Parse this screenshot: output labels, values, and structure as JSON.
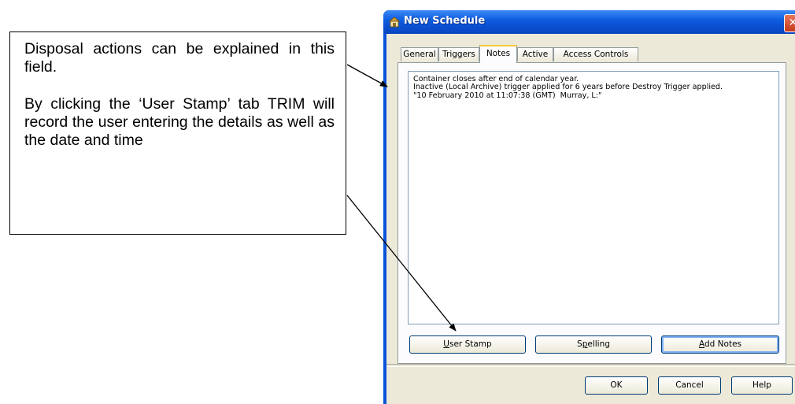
{
  "callout": {
    "paragraph1": "Disposal actions can be explained in this field.",
    "paragraph2": "By clicking the ‘User Stamp’ tab TRIM will record the user entering the details as well as the date and time"
  },
  "window": {
    "title": "New Schedule",
    "title_icon": "schedule-icon",
    "close_glyph": "✕",
    "tabs": [
      {
        "label": "General"
      },
      {
        "label": "Triggers"
      },
      {
        "label": "Notes"
      },
      {
        "label": "Active"
      },
      {
        "label": "Access Controls"
      }
    ],
    "active_tab": "Notes",
    "notes_text": "Container closes after end of calendar year.\nInactive (Local Archive) trigger applied for 6 years before Destroy Trigger applied.\n\"10 February 2010 at 11:07:38 (GMT)  Murray, L:\"",
    "buttons": {
      "user_stamp": "User Stamp",
      "spelling": "Spelling",
      "add_notes": "Add Notes",
      "ok": "OK",
      "cancel": "Cancel",
      "help": "Help"
    }
  },
  "colors": {
    "titlebar": "#0a52d8",
    "dialog_bg": "#ece9d8",
    "active_tab_accent": "#ffc83c"
  }
}
